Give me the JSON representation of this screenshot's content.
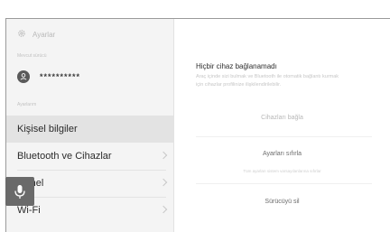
{
  "header": {
    "title": "Ayarlar"
  },
  "left": {
    "current_driver_label": "Mevcut sürücü",
    "driver_name": "**********",
    "settings_label": "Ayarlarım",
    "items": [
      {
        "label": "Kişisel bilgiler"
      },
      {
        "label": "Bluetooth ve Cihazlar"
      },
      {
        "label": "Genel"
      },
      {
        "label": "Wi-Fi"
      }
    ]
  },
  "right": {
    "title": "Hiçbir cihaz bağlanamadı",
    "body": "Araç içinde sizi bulmak ve Bluetooth ile otomatik bağlantı kurmak için cihazlar profilinize ilişkilendirilebilir.",
    "connect_button": "Cihazları bağla",
    "reset_button": "Ayarları sıfırla",
    "reset_note": "Tüm ayarları sistem varsayılanlarına sıfırlar",
    "delete_button": "Sürücüyü sil"
  }
}
